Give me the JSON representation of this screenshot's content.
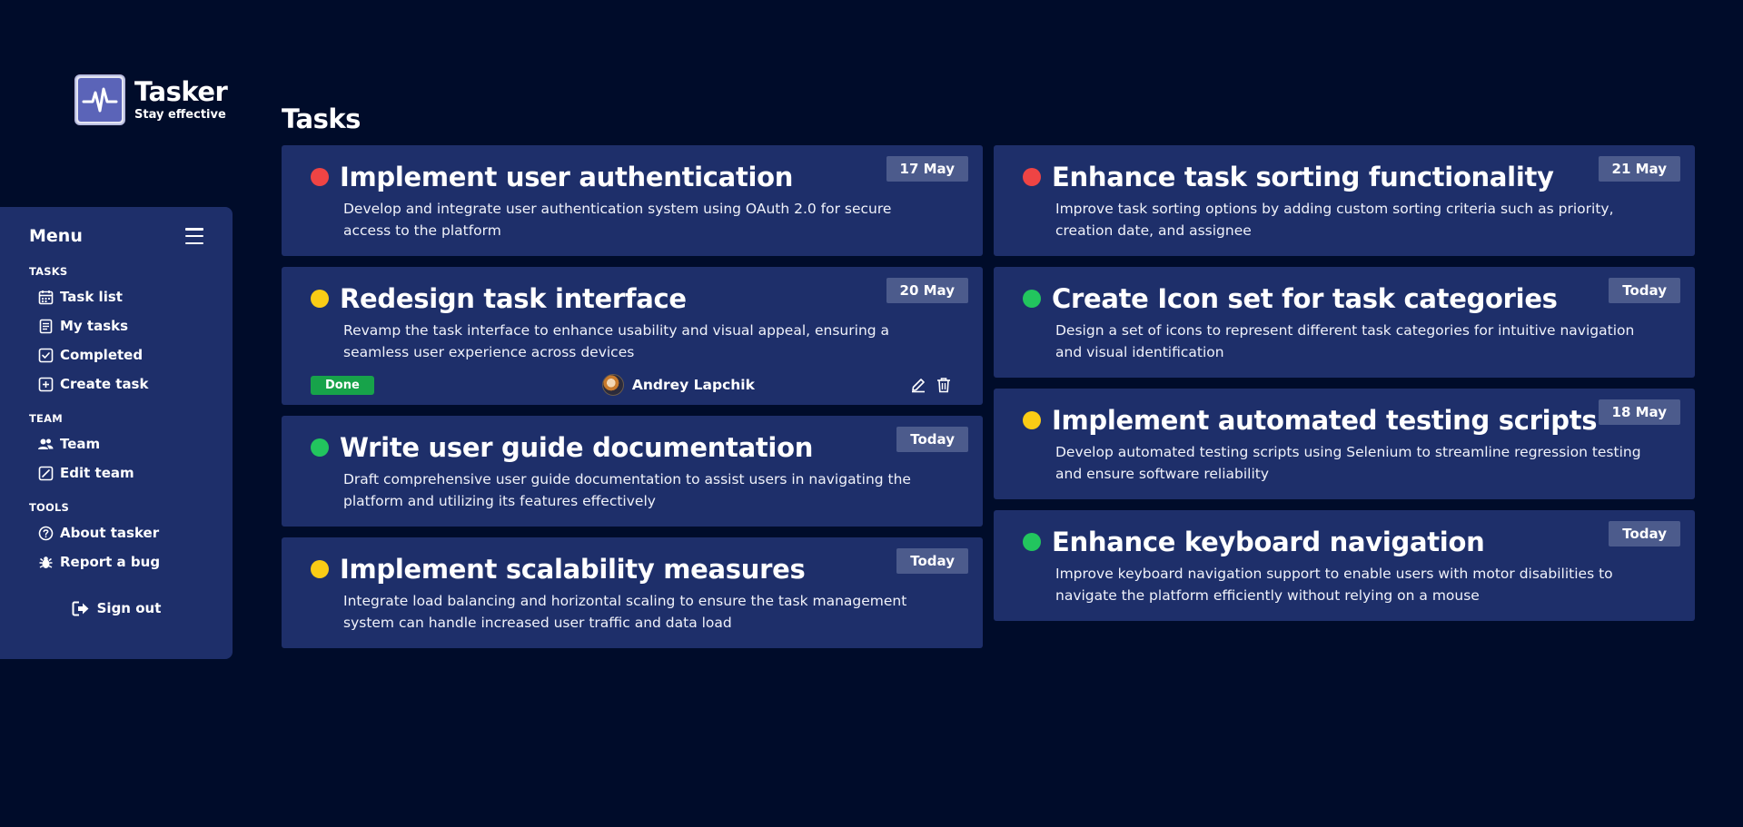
{
  "app": {
    "name": "Tasker",
    "tagline": "Stay effective"
  },
  "page": {
    "title": "Tasks"
  },
  "sidebar": {
    "title": "Menu",
    "sections": [
      {
        "label": "TASKS",
        "items": [
          {
            "label": "Task list",
            "icon": "calendar-icon"
          },
          {
            "label": "My tasks",
            "icon": "document-icon"
          },
          {
            "label": "Completed",
            "icon": "check-square-icon"
          },
          {
            "label": "Create task",
            "icon": "plus-square-icon"
          }
        ]
      },
      {
        "label": "TEAM",
        "items": [
          {
            "label": "Team",
            "icon": "users-icon"
          },
          {
            "label": "Edit team",
            "icon": "edit-square-icon"
          }
        ]
      },
      {
        "label": "TOOLS",
        "items": [
          {
            "label": "About tasker",
            "icon": "question-circle-icon"
          },
          {
            "label": "Report a bug",
            "icon": "bug-icon"
          }
        ]
      }
    ],
    "signout": "Sign out"
  },
  "colors": {
    "red": "#ef4444",
    "yellow": "#facc15",
    "green": "#22c55e",
    "done": "#17a34a"
  },
  "tasks_left": [
    {
      "title": "Implement user authentication",
      "description": "Develop and integrate user authentication system using OAuth 2.0 for secure access to the platform",
      "date": "17 May",
      "priority": "red"
    },
    {
      "title": "Redesign task interface",
      "description": "Revamp the task interface to enhance usability and visual appeal, ensuring a seamless user experience across devices",
      "date": "20 May",
      "priority": "yellow",
      "expanded": true,
      "status": "Done",
      "assignee": "Andrey Lapchik"
    },
    {
      "title": "Write user guide documentation",
      "description": "Draft comprehensive user guide documentation to assist users in navigating the platform and utilizing its features effectively",
      "date": "Today",
      "priority": "green"
    },
    {
      "title": "Implement scalability measures",
      "description": "Integrate load balancing and horizontal scaling to ensure the task management system can handle increased user traffic and data load",
      "date": "Today",
      "priority": "yellow"
    }
  ],
  "tasks_right": [
    {
      "title": "Enhance task sorting functionality",
      "description": "Improve task sorting options by adding custom sorting criteria such as priority, creation date, and assignee",
      "date": "21 May",
      "priority": "red"
    },
    {
      "title": "Create Icon set for task categories",
      "description": "Design a set of icons to represent different task categories for intuitive navigation and visual identification",
      "date": "Today",
      "priority": "green"
    },
    {
      "title": "Implement automated testing scripts",
      "description": "Develop automated testing scripts using Selenium to streamline regression testing and ensure software reliability",
      "date": "18 May",
      "priority": "yellow"
    },
    {
      "title": "Enhance keyboard navigation",
      "description": "Improve keyboard navigation support to enable users with motor disabilities to navigate the platform efficiently without relying on a mouse",
      "date": "Today",
      "priority": "green"
    }
  ]
}
